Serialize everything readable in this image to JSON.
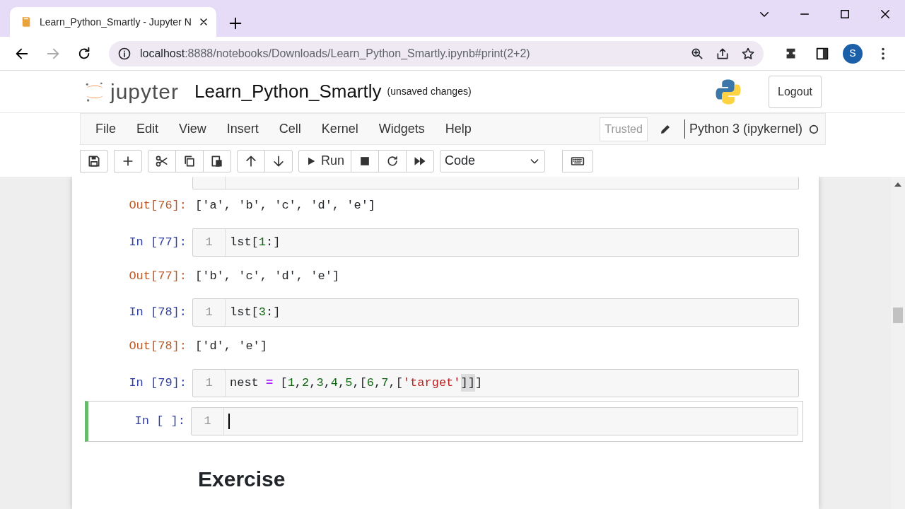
{
  "browser": {
    "tab_title": "Learn_Python_Smartly - Jupyter N",
    "url_host": "localhost",
    "url_rest": ":8888/notebooks/Downloads/Learn_Python_Smartly.ipynb#print(2+2)",
    "profile_initial": "S",
    "forward_disabled": true
  },
  "header": {
    "logo_text": "jupyter",
    "notebook_name": "Learn_Python_Smartly",
    "save_status": "(unsaved changes)",
    "logout": "Logout"
  },
  "menu": {
    "items": [
      "File",
      "Edit",
      "View",
      "Insert",
      "Cell",
      "Kernel",
      "Widgets",
      "Help"
    ],
    "trusted": "Trusted",
    "kernel": "Python 3 (ipykernel)",
    "kernel_busy": false
  },
  "toolbar": {
    "run_label": "Run",
    "cell_type": "Code"
  },
  "cells": [
    {
      "kind": "cut"
    },
    {
      "kind": "output",
      "prompt": "Out[76]:",
      "text": "['a', 'b', 'c', 'd', 'e']"
    },
    {
      "kind": "input",
      "prompt": "In [77]:",
      "line_number": "1",
      "selected": false,
      "tokens": [
        {
          "kind": "name",
          "text": "lst"
        },
        {
          "kind": "punct",
          "text": "["
        },
        {
          "kind": "num",
          "text": "1"
        },
        {
          "kind": "punct",
          "text": ":]"
        }
      ]
    },
    {
      "kind": "output",
      "prompt": "Out[77]:",
      "text": "['b', 'c', 'd', 'e']"
    },
    {
      "kind": "input",
      "prompt": "In [78]:",
      "line_number": "1",
      "selected": false,
      "tokens": [
        {
          "kind": "name",
          "text": "lst"
        },
        {
          "kind": "punct",
          "text": "["
        },
        {
          "kind": "num",
          "text": "3"
        },
        {
          "kind": "punct",
          "text": ":]"
        }
      ]
    },
    {
      "kind": "output",
      "prompt": "Out[78]:",
      "text": "['d', 'e']"
    },
    {
      "kind": "input",
      "prompt": "In [79]:",
      "line_number": "1",
      "selected": false,
      "tokens": [
        {
          "kind": "name",
          "text": "nest "
        },
        {
          "kind": "op",
          "text": "="
        },
        {
          "kind": "punct",
          "text": " ["
        },
        {
          "kind": "num",
          "text": "1"
        },
        {
          "kind": "punct",
          "text": ","
        },
        {
          "kind": "num",
          "text": "2"
        },
        {
          "kind": "punct",
          "text": ","
        },
        {
          "kind": "num",
          "text": "3"
        },
        {
          "kind": "punct",
          "text": ","
        },
        {
          "kind": "num",
          "text": "4"
        },
        {
          "kind": "punct",
          "text": ","
        },
        {
          "kind": "num",
          "text": "5"
        },
        {
          "kind": "punct",
          "text": ",["
        },
        {
          "kind": "num",
          "text": "6"
        },
        {
          "kind": "punct",
          "text": ","
        },
        {
          "kind": "num",
          "text": "7"
        },
        {
          "kind": "punct",
          "text": ",["
        },
        {
          "kind": "str",
          "text": "'target'"
        },
        {
          "kind": "match",
          "text": "]]"
        },
        {
          "kind": "punct",
          "text": "]"
        }
      ]
    },
    {
      "kind": "input",
      "prompt": "In [ ]:",
      "line_number": "1",
      "selected": true
    },
    {
      "kind": "markdown",
      "text": "Exercise"
    }
  ]
}
